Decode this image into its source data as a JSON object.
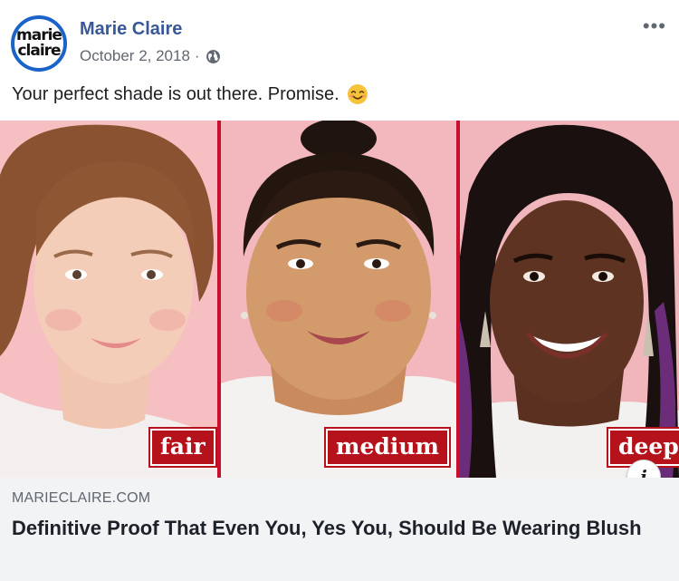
{
  "header": {
    "avatar_text_line1": "marie",
    "avatar_text_line2": "claire",
    "page_name": "Marie Claire",
    "date": "October 2, 2018",
    "separator": "·",
    "privacy_icon": "globe-icon",
    "more_label": "•••"
  },
  "post": {
    "text": "Your perfect shade is out there. Promise.",
    "emoji": "smiling-face-with-smiling-eyes-emoji"
  },
  "image": {
    "labels": [
      "fair",
      "medium",
      "deep"
    ],
    "accent_color": "#b5121b",
    "info_label": "i"
  },
  "link_preview": {
    "domain": "MARIECLAIRE.COM",
    "headline": "Definitive Proof That Even You, Yes You, Should Be Wearing Blush"
  },
  "colors": {
    "link_blue": "#385898",
    "avatar_ring": "#1a63c9",
    "preview_bg": "#f2f3f5"
  }
}
